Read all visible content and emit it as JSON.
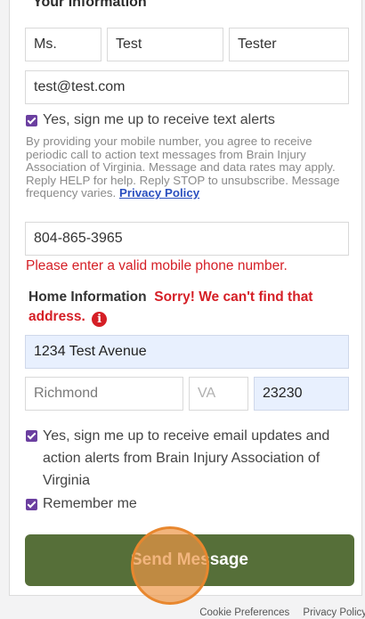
{
  "form": {
    "section_title": "Your Information",
    "salutation": "Ms.",
    "first_name": "Test",
    "last_name": "Tester",
    "email": "test@test.com",
    "sms_opt_in_label": "Yes, sign me up to receive text alerts",
    "disclaimer_text": "By providing your mobile number, you agree to receive periodic call to action text messages from Brain Injury Association of Virginia. Message and data rates may apply. Reply HELP for help. Reply STOP to unsubscribe. Message frequency varies.",
    "privacy_link": "Privacy Policy",
    "phone": "804-865-3965",
    "phone_error": "Please enter a valid mobile phone number.",
    "home_heading": "Home Information",
    "address_error": "Sorry! We can't find that address.",
    "address": "1234 Test Avenue",
    "city": "Richmond",
    "state": "VA",
    "zip": "23230",
    "email_opt_in_label": "Yes, sign me up to receive email updates and action alerts from Brain Injury Association of Virginia",
    "remember_label": "Remember me",
    "submit_label": "Send Message"
  },
  "footer": {
    "cookie_prefs": "Cookie Preferences",
    "privacy_policy": "Privacy Policy"
  },
  "colors": {
    "accent_purple": "#6b3fa0",
    "error_red": "#d51f26",
    "button_green": "#566f39",
    "autofill_blue": "#e8f0fe"
  },
  "icons": {
    "info": "info-circle-icon",
    "check": "check-icon"
  }
}
